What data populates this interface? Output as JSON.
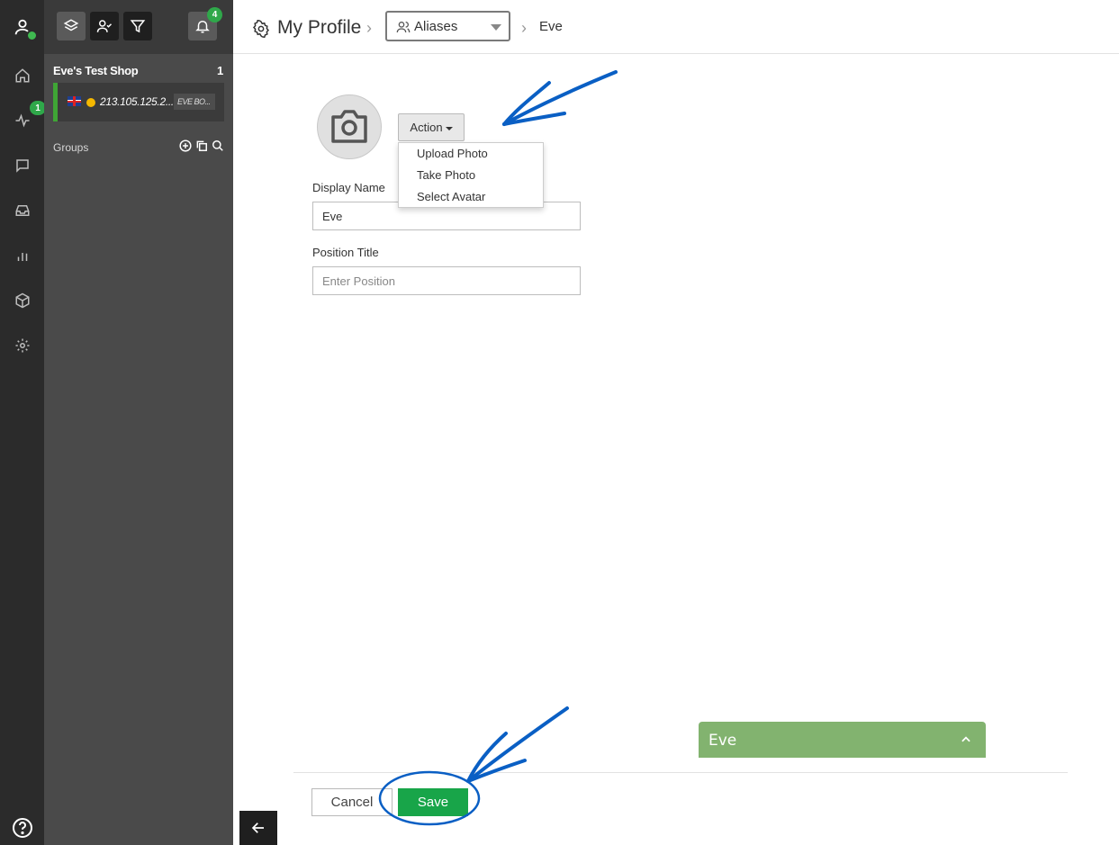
{
  "rail": {
    "items": [
      {
        "icon": "home-icon"
      },
      {
        "icon": "activity-icon",
        "badge": "1"
      },
      {
        "icon": "chat-icon"
      },
      {
        "icon": "inbox-icon"
      },
      {
        "icon": "bar-chart-icon"
      },
      {
        "icon": "package-icon"
      },
      {
        "icon": "gear-icon"
      }
    ],
    "help_icon": "help-icon"
  },
  "toolbar": {
    "notification_count": "4"
  },
  "shop": {
    "title": "Eve's Test Shop",
    "count": "1",
    "session": {
      "ip": "213.105.125.2...",
      "tag": "EVE BO..."
    },
    "groups_label": "Groups"
  },
  "header": {
    "title": "My Profile",
    "alias_select": "Aliases",
    "breadcrumb_current": "Eve"
  },
  "profile": {
    "action_label": "Action",
    "menu": [
      "Upload Photo",
      "Take Photo",
      "Select Avatar"
    ],
    "display_name_label": "Display Name",
    "display_name_value": "Eve",
    "position_label": "Position Title",
    "position_placeholder": "Enter Position"
  },
  "chat": {
    "name": "Eve"
  },
  "footer": {
    "cancel_label": "Cancel",
    "save_label": "Save"
  },
  "colors": {
    "accent_green": "#18a549",
    "chat_green": "#82b36f",
    "annotation_blue": "#0a5fc4"
  }
}
